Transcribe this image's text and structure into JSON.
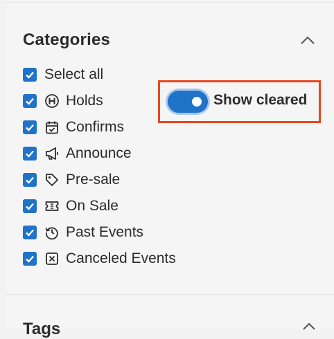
{
  "section": {
    "title": "Categories",
    "collapse_icon": "chevron-up-icon"
  },
  "categories": [
    {
      "label": "Select all",
      "checked": true,
      "icon": ""
    },
    {
      "label": "Holds",
      "checked": true,
      "icon": "h-circle-icon"
    },
    {
      "label": "Confirms",
      "checked": true,
      "icon": "calendar-check-icon"
    },
    {
      "label": "Announce",
      "checked": true,
      "icon": "megaphone-icon"
    },
    {
      "label": "Pre-sale",
      "checked": true,
      "icon": "tag-icon"
    },
    {
      "label": "On Sale",
      "checked": true,
      "icon": "ticket-icon"
    },
    {
      "label": "Past Events",
      "checked": true,
      "icon": "history-icon"
    },
    {
      "label": "Canceled Events",
      "checked": true,
      "icon": "x-square-icon"
    }
  ],
  "show_cleared": {
    "label": "Show cleared",
    "on": true
  },
  "next_section": {
    "title": "Tags"
  },
  "colors": {
    "accent": "#1f73c9",
    "highlight_border": "#e8471d"
  }
}
